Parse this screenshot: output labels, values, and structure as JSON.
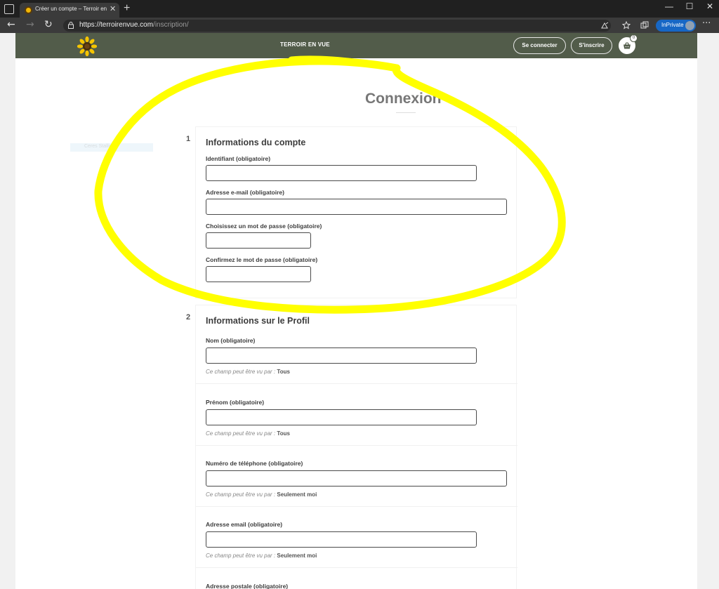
{
  "browser": {
    "tab_title": "Créer un compte – Terroir en Vue",
    "tab_close": "✕",
    "new_tab": "+",
    "url_host": "https://terroirenvue.com",
    "url_path": "/inscription/",
    "inprivate_label": "InPrivate",
    "window_controls": {
      "minimize": "—",
      "maximize": "☐",
      "close": "✕"
    },
    "nav": {
      "back": "←",
      "forward": "→",
      "reload": "↻"
    },
    "more": "···",
    "icons": [
      "tab-actions-icon",
      "favicon-sunflower",
      "lock-icon",
      "read-aloud-icon",
      "favorites-star-icon",
      "collections-icon",
      "profile-avatar",
      "more-icon"
    ]
  },
  "site": {
    "brand": "TERROIR EN VUE",
    "login_button": "Se connecter",
    "signup_button": "S'inscrire",
    "cart_count": "0",
    "header_color": "#525c4a"
  },
  "page": {
    "title": "Connexion",
    "faint_widget_label": "Ceres Stallion"
  },
  "sections": [
    {
      "number": "1",
      "title": "Informations du compte",
      "fields": [
        {
          "label": "Identifiant (obligatoire)"
        },
        {
          "label": "Adresse e-mail (obligatoire)"
        },
        {
          "label": "Choisissez un mot de passe (obligatoire)"
        },
        {
          "label": "Confirmez le mot de passe (obligatoire)"
        }
      ]
    },
    {
      "number": "2",
      "title": "Informations sur le Profil",
      "visibility_prefix": "Ce champ peut être vu par :",
      "fields": [
        {
          "label": "Nom (obligatoire)",
          "visibility": "Tous"
        },
        {
          "label": "Prénom (obligatoire)",
          "visibility": "Tous"
        },
        {
          "label": "Numéro de téléphone (obligatoire)",
          "visibility": "Seulement moi"
        },
        {
          "label": "Adresse email (obligatoire)",
          "visibility": "Seulement moi"
        },
        {
          "label": "Adresse postale (obligatoire)"
        }
      ]
    }
  ],
  "annotation_color": "#ffff00"
}
